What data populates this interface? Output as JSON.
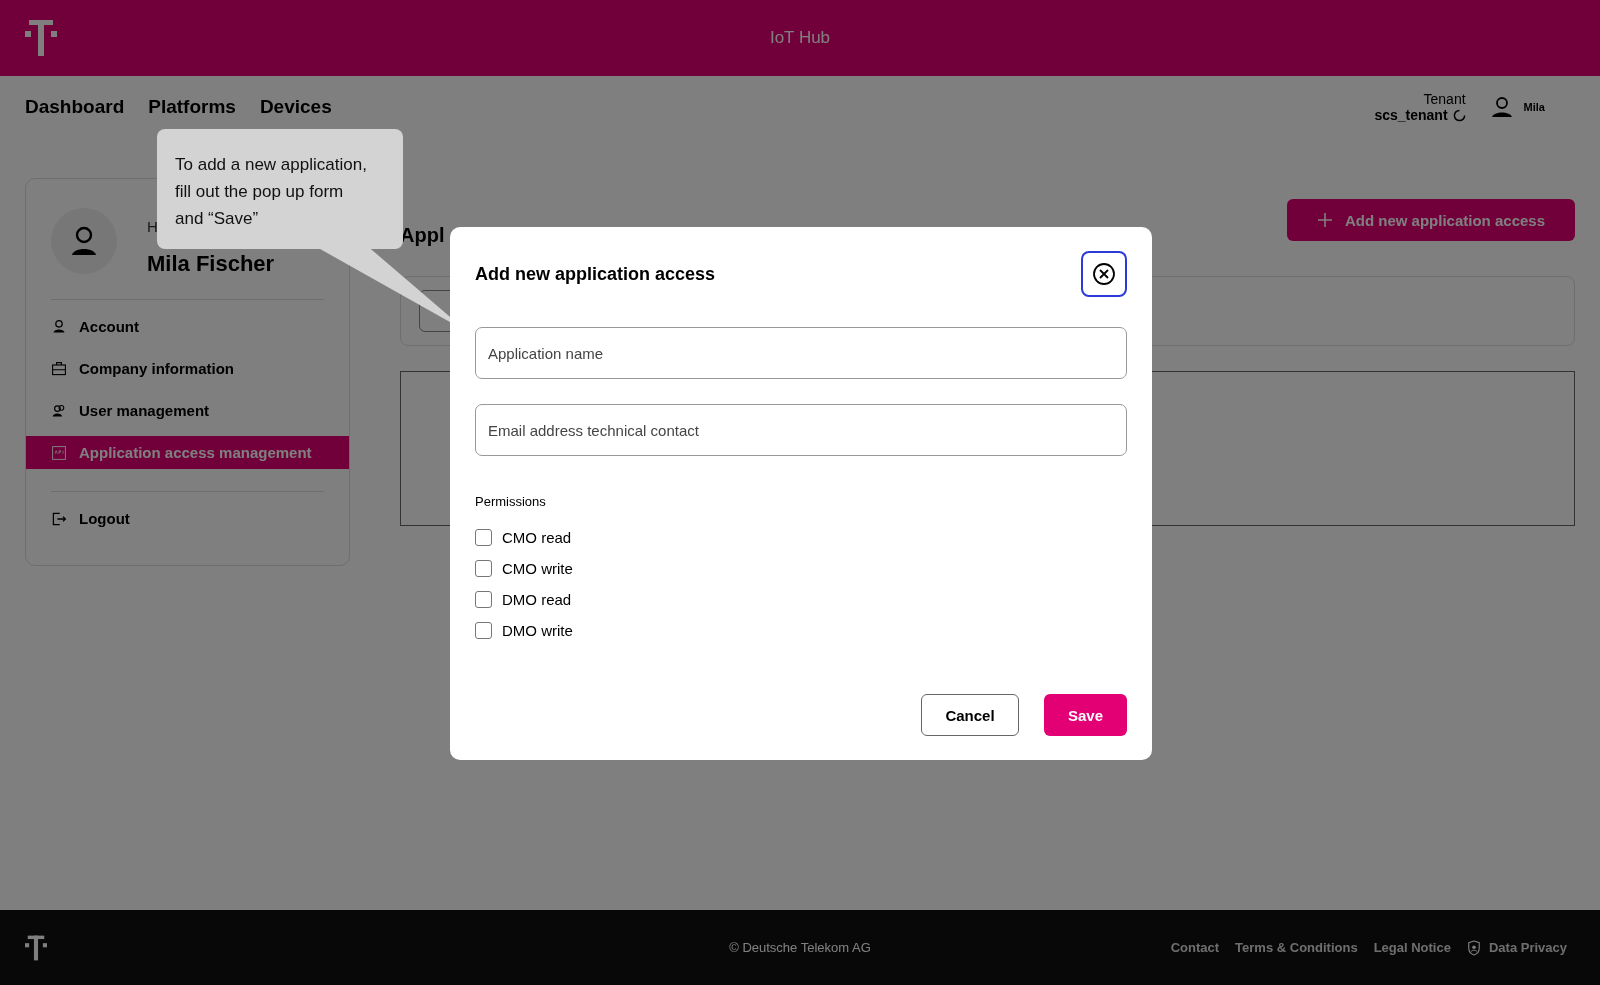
{
  "header": {
    "title": "IoT Hub"
  },
  "nav": [
    {
      "label": "Dashboard"
    },
    {
      "label": "Platforms"
    },
    {
      "label": "Devices"
    }
  ],
  "tenant": {
    "label": "Tenant",
    "value": "scs_tenant"
  },
  "user": {
    "name": "Mila"
  },
  "profile": {
    "greeting": "H",
    "name": "Mila Fischer"
  },
  "sidebar": {
    "items": [
      {
        "label": "Account",
        "kind": "user",
        "selected": false
      },
      {
        "label": "Company information",
        "kind": "briefcase",
        "selected": false
      },
      {
        "label": "User management",
        "kind": "users",
        "selected": false
      },
      {
        "label": "Application access management",
        "kind": "api",
        "selected": true
      }
    ],
    "logout": "Logout"
  },
  "content": {
    "heading": "Appl",
    "add_button": "Add new application access"
  },
  "tooltip": {
    "text": "To add a new application, fill out the pop up form and “Save”"
  },
  "modal": {
    "title": "Add new application access",
    "fields": [
      {
        "placeholder": "Application name"
      },
      {
        "placeholder": "Email address technical contact"
      }
    ],
    "permissions_label": "Permissions",
    "permissions": [
      {
        "label": "CMO read",
        "checked": false
      },
      {
        "label": "CMO write",
        "checked": false
      },
      {
        "label": "DMO read",
        "checked": false
      },
      {
        "label": "DMO write",
        "checked": false
      }
    ],
    "cancel": "Cancel",
    "save": "Save"
  },
  "footer": {
    "copyright": "© Deutsche Telekom AG",
    "links": [
      {
        "label": "Contact",
        "kind": "link"
      },
      {
        "label": "Terms & Conditions",
        "kind": "link"
      },
      {
        "label": "Legal Notice",
        "kind": "link"
      },
      {
        "label": "Data Privacy",
        "kind": "privacy"
      }
    ]
  }
}
